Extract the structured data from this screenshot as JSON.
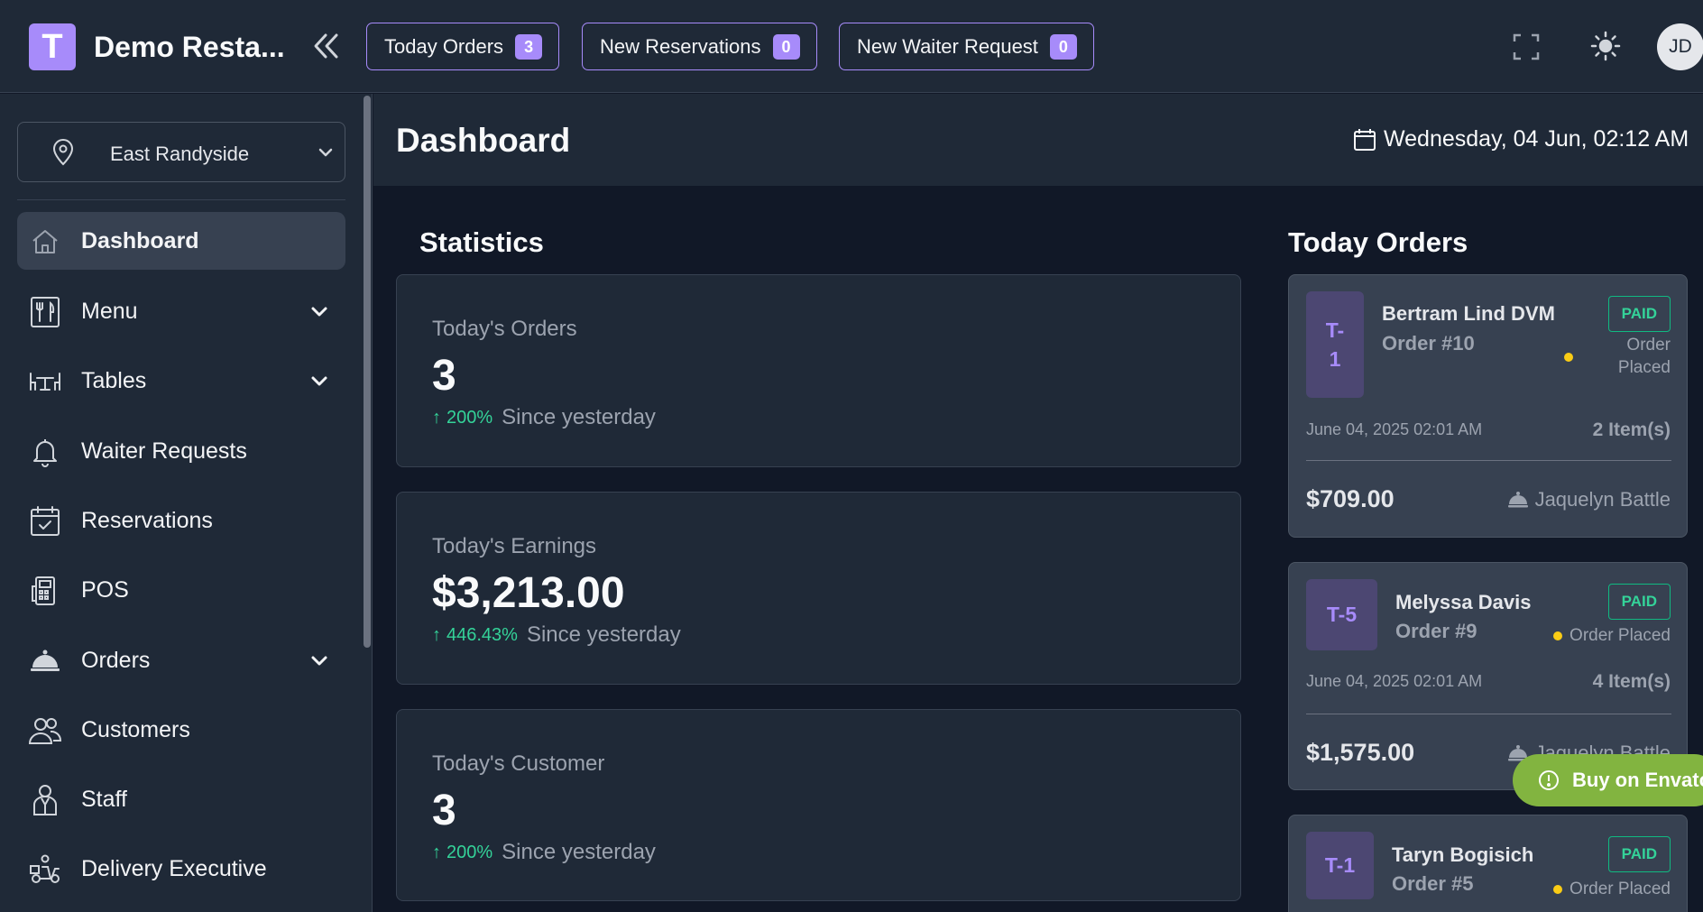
{
  "app": {
    "logo_letter": "T",
    "title": "Demo Resta...",
    "brand_color": "#a78bfa"
  },
  "topbar": {
    "pills": [
      {
        "label": "Today Orders",
        "count": "3"
      },
      {
        "label": "New Reservations",
        "count": "0"
      },
      {
        "label": "New Waiter Request",
        "count": "0"
      }
    ],
    "avatar_initials": "JD"
  },
  "sidebar": {
    "location": "East Randyside",
    "items": [
      {
        "label": "Dashboard",
        "icon": "home-icon",
        "active": true
      },
      {
        "label": "Menu",
        "icon": "menu-icon",
        "expandable": true
      },
      {
        "label": "Tables",
        "icon": "table-icon",
        "expandable": true
      },
      {
        "label": "Waiter Requests",
        "icon": "bell-icon"
      },
      {
        "label": "Reservations",
        "icon": "calendar-check-icon"
      },
      {
        "label": "POS",
        "icon": "pos-icon"
      },
      {
        "label": "Orders",
        "icon": "cloche-icon",
        "expandable": true
      },
      {
        "label": "Customers",
        "icon": "users-icon"
      },
      {
        "label": "Staff",
        "icon": "staff-icon"
      },
      {
        "label": "Delivery Executive",
        "icon": "scooter-icon"
      }
    ]
  },
  "header": {
    "title": "Dashboard",
    "datetime": "Wednesday, 04 Jun, 02:12 AM"
  },
  "statistics": {
    "title": "Statistics",
    "cards": [
      {
        "label": "Today's Orders",
        "value": "3",
        "change": "200%",
        "since": "Since yesterday"
      },
      {
        "label": "Today's Earnings",
        "value": "$3,213.00",
        "change": "446.43%",
        "since": "Since yesterday"
      },
      {
        "label": "Today's Customer",
        "value": "3",
        "change": "200%",
        "since": "Since yesterday"
      }
    ]
  },
  "orders": {
    "title": "Today Orders",
    "list": [
      {
        "table": "T-\n1",
        "customer": "Bertram Lind DVM",
        "order_no": "Order #10",
        "payment": "PAID",
        "status": "Order\nPlaced",
        "date": "June 04, 2025 02:01 AM",
        "items": "2 Item(s)",
        "price": "$709.00",
        "waiter": "Jaquelyn Battle"
      },
      {
        "table": "T-5",
        "customer": "Melyssa Davis",
        "order_no": "Order #9",
        "payment": "PAID",
        "status": "Order Placed",
        "date": "June 04, 2025 02:01 AM",
        "items": "4 Item(s)",
        "price": "$1,575.00",
        "waiter": "Jaquelyn Battle"
      },
      {
        "table": "T-1",
        "customer": "Taryn Bogisich",
        "order_no": "Order #5",
        "payment": "PAID",
        "status": "Order Placed"
      }
    ]
  },
  "promo": {
    "label": "Buy on Envato"
  }
}
